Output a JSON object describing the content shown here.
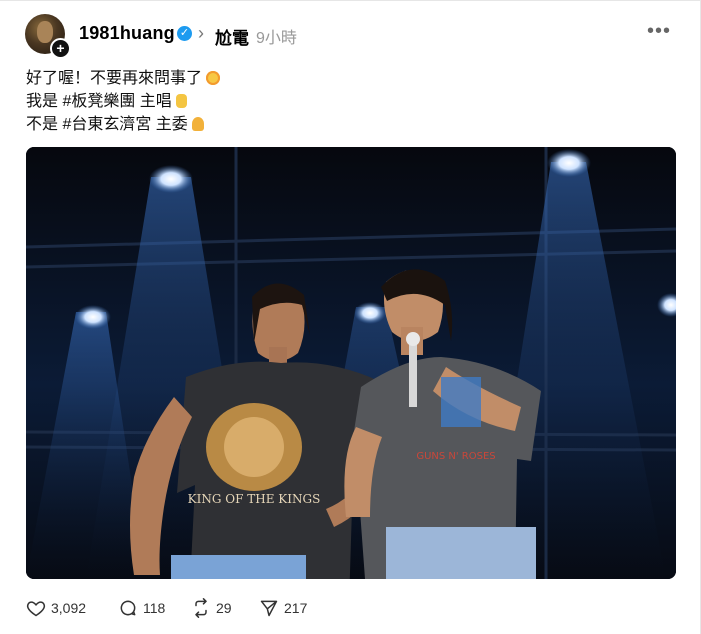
{
  "post": {
    "username": "1981huang",
    "topic": "尬電",
    "time": "9小時",
    "caption_lines": [
      "好了喔！不要再來問事了",
      "我是 #板凳樂團 主唱",
      "不是 #台東玄濟宮 主委"
    ]
  },
  "photo": {
    "shirt_text": "KING OF THE KINGS",
    "shirt2_text": "GUNS N' ROSES"
  },
  "actions": {
    "likes": "3,092",
    "comments": "118",
    "reposts": "29",
    "shares": "217"
  },
  "colors": {
    "verified": "#1d9bf0",
    "text_secondary": "#999999"
  }
}
